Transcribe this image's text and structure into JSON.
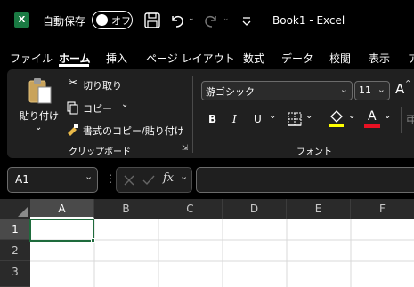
{
  "titlebar": {
    "app_logo": "X",
    "autosave_label": "自動保存",
    "autosave_state": "オフ",
    "doc_title": "Book1  -  Excel",
    "icons": [
      "save-icon",
      "undo-icon",
      "redo-icon",
      "customize-quick-access-icon"
    ]
  },
  "menu": {
    "tabs": [
      "ファイル",
      "ホーム",
      "挿入",
      "ページ レイアウト",
      "数式",
      "データ",
      "校閲",
      "表示",
      "ア"
    ],
    "active_tab": "ホーム"
  },
  "ribbon": {
    "clipboard": {
      "paste_label": "貼り付け",
      "cut_label": "切り取り",
      "copy_label": "コピー",
      "format_painter_label": "書式のコピー/貼り付け",
      "group_label": "クリップボード"
    },
    "font": {
      "font_name": "游ゴシック",
      "font_size": "11",
      "bold": "B",
      "italic": "I",
      "underline": "U",
      "font_color_glyph": "A",
      "grow_font_glyph": "A",
      "group_label": "フォント",
      "highlight_color": "#ffff00",
      "font_color": "#e81123"
    }
  },
  "formula_bar": {
    "name_box_value": "A1",
    "fx_label": "fx",
    "formula_value": ""
  },
  "grid": {
    "columns": [
      "A",
      "B",
      "C",
      "D",
      "E",
      "F"
    ],
    "rows": [
      "1",
      "2",
      "3"
    ],
    "selected_cell": "A1",
    "accent_color": "#1e6b3c"
  }
}
